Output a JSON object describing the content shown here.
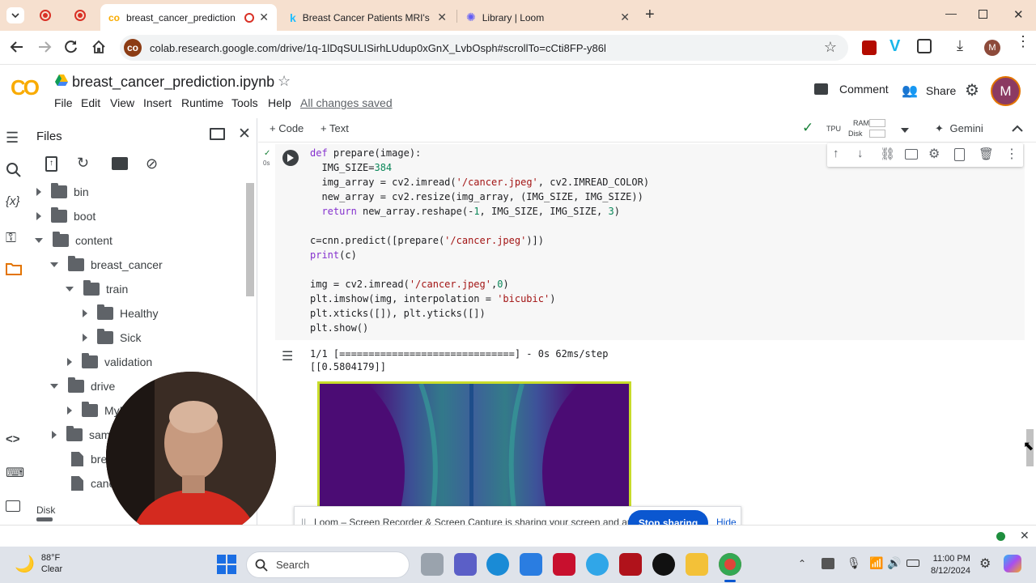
{
  "browser": {
    "tabs": [
      {
        "title": "breast_cancer_prediction.ipynb",
        "active": true
      },
      {
        "title": "Breast Cancer Patients MRI's",
        "active": false
      },
      {
        "title": "Library | Loom",
        "active": false
      }
    ],
    "url": "colab.research.google.com/drive/1q-1lDqSULISirhLUdup0xGnX_LvbOsph#scrollTo=cCti8FP-y86l",
    "profile_initial": "M"
  },
  "colab": {
    "logo": "CO",
    "notebook_title": "breast_cancer_prediction.ipynb",
    "menu": [
      "File",
      "Edit",
      "View",
      "Insert",
      "Runtime",
      "Tools",
      "Help"
    ],
    "save_status": "All changes saved",
    "comment_label": "Comment",
    "share_label": "Share",
    "avatar_initial": "M",
    "add_code_label": "+ Code",
    "add_text_label": "+ Text",
    "runtime_type": "TPU",
    "ram_label": "RAM",
    "disk_label": "Disk",
    "gemini_label": "Gemini",
    "exec_time": "0s"
  },
  "files_panel": {
    "title": "Files",
    "disk_label": "Disk",
    "tree": [
      {
        "name": "bin",
        "type": "folder",
        "depth": 0,
        "expanded": false
      },
      {
        "name": "boot",
        "type": "folder",
        "depth": 0,
        "expanded": false
      },
      {
        "name": "content",
        "type": "folder",
        "depth": 0,
        "expanded": true
      },
      {
        "name": "breast_cancer",
        "type": "folder",
        "depth": 1,
        "expanded": true
      },
      {
        "name": "train",
        "type": "folder",
        "depth": 2,
        "expanded": true
      },
      {
        "name": "Healthy",
        "type": "folder",
        "depth": 3,
        "expanded": false
      },
      {
        "name": "Sick",
        "type": "folder",
        "depth": 3,
        "expanded": false
      },
      {
        "name": "validation",
        "type": "folder",
        "depth": 2,
        "expanded": false
      },
      {
        "name": "drive",
        "type": "folder",
        "depth": 1,
        "expanded": true
      },
      {
        "name": "MyD",
        "type": "folder",
        "depth": 2,
        "expanded": false
      },
      {
        "name": "sam",
        "type": "folder",
        "depth": 1,
        "expanded": false
      },
      {
        "name": "brea",
        "type": "file",
        "depth": 1
      },
      {
        "name": "canc",
        "type": "file",
        "depth": 1
      }
    ]
  },
  "code_lines": [
    "def prepare(image):",
    "  IMG_SIZE=384",
    "  img_array = cv2.imread('/cancer.jpeg', cv2.IMREAD_COLOR)",
    "  new_array = cv2.resize(img_array, (IMG_SIZE, IMG_SIZE))",
    "  return new_array.reshape(-1, IMG_SIZE, IMG_SIZE, 3)",
    "",
    "c=cnn.predict([prepare('/cancer.jpeg')])",
    "print(c)",
    "",
    "img = cv2.imread('/cancer.jpeg',0)",
    "plt.imshow(img, interpolation = 'bicubic')",
    "plt.xticks([]), plt.yticks([])",
    "plt.show()"
  ],
  "output": {
    "progress_line": "1/1 [==============================] - 0s 62ms/step",
    "prediction": "[[0.5804179]]"
  },
  "loom": {
    "message": "Loom – Screen Recorder & Screen Capture is sharing your screen and audio.",
    "stop_label": "Stop sharing",
    "hide_label": "Hide"
  },
  "taskbar": {
    "weather_temp": "88°F",
    "weather_desc": "Clear",
    "search_placeholder": "Search",
    "time": "11:00 PM",
    "date": "8/12/2024"
  }
}
